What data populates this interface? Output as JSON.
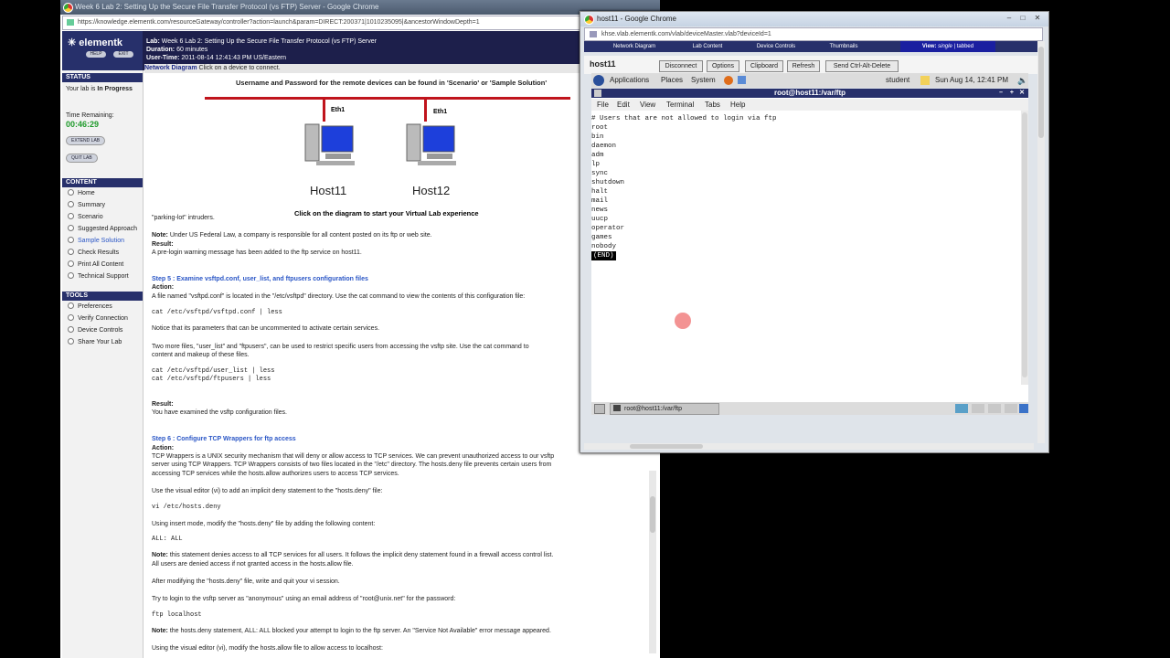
{
  "win1": {
    "title": "Week 6 Lab 2: Setting Up the Secure File Transfer Protocol (vs FTP) Server - Google Chrome",
    "url": "https://knowledge.elementk.com/resourceGateway/controller?action=launch&param=DIRECT:200371|1010235095|&ancestorWindowDepth=1"
  },
  "lab": {
    "logo": "elementk",
    "help": "HELP",
    "exit": "EXIT",
    "lab_label": "Lab:",
    "lab_name": "Week 6 Lab 2: Setting Up the Secure File Transfer Protocol (vs FTP) Server",
    "duration_label": "Duration:",
    "duration": "60 minutes",
    "usertime_label": "User-Time:",
    "usertime": "2011-08-14 12:41:43 PM US/Eastern"
  },
  "sidebar": {
    "status_h": "STATUS",
    "status_text": "Your lab is",
    "status_value": "In Progress",
    "time_label": "Time Remaining:",
    "time_value": "00:46:29",
    "extend": "EXTEND LAB",
    "quit": "QUIT LAB",
    "content_h": "CONTENT",
    "content_items": [
      "Home",
      "Summary",
      "Scenario",
      "Suggested Approach",
      "Sample Solution",
      "Check Results",
      "Print All Content",
      "Technical Support"
    ],
    "tools_h": "TOOLS",
    "tools_items": [
      "Preferences",
      "Verify Connection",
      "Device Controls",
      "Share Your Lab"
    ]
  },
  "main": {
    "nd_title": "Network Diagram",
    "nd_hint": "Click on a device to connect.",
    "creds_note": "Username and Password for the remote devices can be found in 'Scenario' or 'Sample Solution'",
    "eth1": "Eth1",
    "host11": "Host11",
    "host12": "Host12",
    "click_note": "Click on the diagram to start your Virtual Lab experience",
    "parking": "\"parking-lot\" intruders.",
    "note1_label": "Note:",
    "note1": "Under US Federal Law, a company is responsible for all content posted on its ftp or web site.",
    "result_label": "Result:",
    "result1": "A pre-login warning message has been added to the ftp service on host11.",
    "step5": "Step 5 : Examine vsftpd.conf, user_list, and ftpusers configuration files",
    "action_label": "Action:",
    "step5_a": "A file named \"vsftpd.conf\" is located in the \"/etc/vsftpd\" directory. Use the cat command to view the contents of this configuration file:",
    "cmd_cat1": "cat      /etc/vsftpd/vsftpd.conf      |      less",
    "step5_b": "Notice that its parameters that can be uncommented to activate certain services.",
    "step5_c1": "Two more files, \"user_list\" and \"ftpusers\", can be used to restrict specific users from accessing the vsftp site. Use the cat command to",
    "step5_c2": "content and makeup of these files.",
    "cmd_cat2": "cat      /etc/vsftpd/user_list     |      less",
    "cmd_cat3": "cat      /etc/vsftpd/ftpusers      |      less",
    "result2": "You have examined the vsftp configuration files.",
    "step6": "Step 6 : Configure TCP Wrappers for ftp access",
    "step6_a1": "TCP Wrappers is a UNIX security mechanism that will deny or allow access to TCP services. We can prevent unauthorized access to our vsftp",
    "step6_a2": "server using TCP Wrappers. TCP Wrappers consists of two files located in the \"/etc\" directory. The hosts.deny file prevents certain users from",
    "step6_a3": "accessing TCP services while the hosts.allow authorizes users to access TCP services.",
    "step6_b": "Use the visual editor (vi) to add an implicit deny statement to the \"hosts.deny\" file:",
    "cmd_vi": "vi     /etc/hosts.deny",
    "step6_c": "Using insert mode, modify the \"hosts.deny\" file by adding the following content:",
    "cmd_all": "ALL: ALL",
    "note2_label": "Note:",
    "note2a": "this statement denies access to all TCP services for all users. It follows the implicit deny statement found in a firewall access control list.",
    "note2b": "All users are denied access if not granted access in the hosts.allow file.",
    "step6_d": "After modifying the \"hosts.deny\" file, write and quit your vi session.",
    "step6_e": "Try to login to the vsftp server as \"anonymous\" using an email address of \"root@unix.net\" for the password:",
    "cmd_ftp": "ftp       localhost",
    "note3_label": "Note:",
    "note3": "the hosts.deny statement, ALL: ALL blocked your attempt to login to the ftp server. An \"Service Not Available\" error message appeared.",
    "step6_f": "Using the visual editor (vi), modify the hosts.allow file to allow access to localhost:"
  },
  "win2": {
    "title": "host11 - Google Chrome",
    "url": "khse.vlab.elementk.com/vlab/deviceMaster.vlab?deviceId=1",
    "tabs": [
      "Network Diagram",
      "Lab Content",
      "Device Controls",
      "Thumbnails"
    ],
    "view_label": "View:",
    "view_single": "single",
    "view_sep": "|",
    "view_tabbed": "tabbed",
    "host": "host11",
    "buttons": [
      "Disconnect",
      "Options",
      "Clipboard",
      "Refresh",
      "Send Ctrl-Alt-Delete"
    ]
  },
  "gnome": {
    "menus": [
      "Applications",
      "Places",
      "System"
    ],
    "user": "student",
    "clock": "Sun Aug 14, 12:41 PM"
  },
  "terminal": {
    "title": "root@host11:/var/ftp",
    "menu": [
      "File",
      "Edit",
      "View",
      "Terminal",
      "Tabs",
      "Help"
    ],
    "lines": [
      "# Users that are not allowed to login via ftp",
      "root",
      "bin",
      "daemon",
      "adm",
      "lp",
      "sync",
      "shutdown",
      "halt",
      "mail",
      "news",
      "uucp",
      "operator",
      "games",
      "nobody"
    ],
    "end_marker": "(END)",
    "task": "root@host11:/var/ftp"
  },
  "colors": {
    "accent": "#27306b",
    "link": "#2a56c6",
    "view": "#1a1fa0"
  }
}
